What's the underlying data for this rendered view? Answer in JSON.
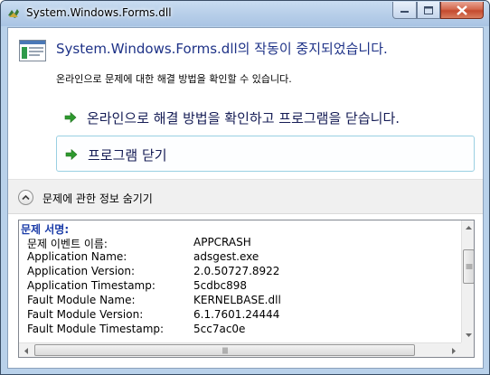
{
  "window": {
    "title": "System.Windows.Forms.dll"
  },
  "header": {
    "title": "System.Windows.Forms.dll의 작동이 중지되었습니다.",
    "subtitle": "온라인으로 문제에 대한 해결 방법을 확인할 수 있습니다."
  },
  "commands": [
    {
      "label": "온라인으로 해결 방법을 확인하고 프로그램을 닫습니다.",
      "icon": "green-arrow-icon"
    },
    {
      "label": "프로그램 닫기",
      "icon": "green-arrow-icon"
    }
  ],
  "details_toggle": {
    "label": "문제에 관한 정보 숨기기",
    "icon": "chevron-up-icon"
  },
  "problem_details": {
    "heading": "문제 서명:",
    "rows": [
      {
        "key": "문제 이벤트 이름:",
        "value": "APPCRASH"
      },
      {
        "key": "Application Name:",
        "value": "adsgest.exe"
      },
      {
        "key": "Application Version:",
        "value": "2.0.50727.8922"
      },
      {
        "key": "Application Timestamp:",
        "value": "5cdbc898"
      },
      {
        "key": "Fault Module Name:",
        "value": "KERNELBASE.dll"
      },
      {
        "key": "Fault Module Version:",
        "value": "6.1.7601.24444"
      },
      {
        "key": "Fault Module Timestamp:",
        "value": "5cc7ac0e"
      }
    ]
  },
  "colors": {
    "title_blue": "#1e3287",
    "command_text": "#151c55",
    "heading_blue": "#1b3ca8",
    "arrow_green": "#2e9a2e"
  }
}
